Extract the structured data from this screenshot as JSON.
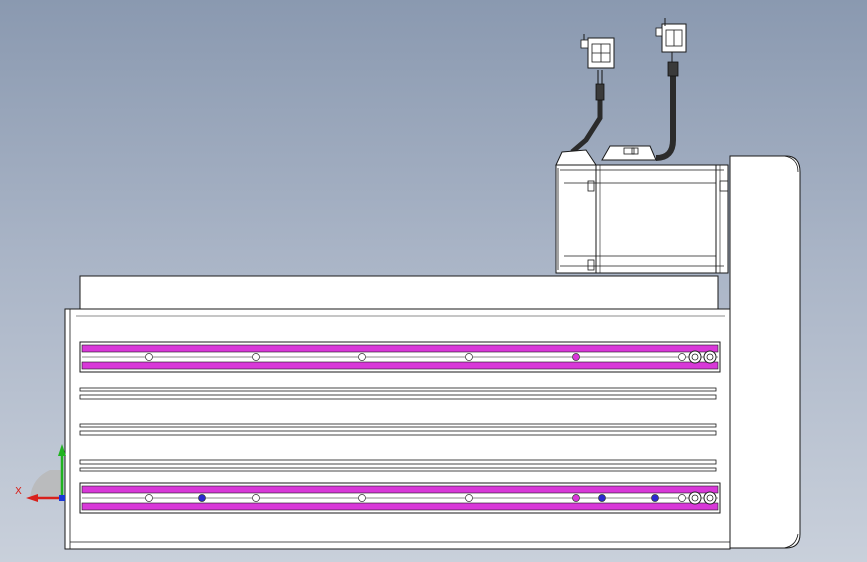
{
  "viewport": {
    "background_top": "#8a99b0",
    "background_bottom": "#c9d0db"
  },
  "triad": {
    "x_label": "X",
    "x_color": "#d8201a",
    "y_color": "#1fb31f",
    "z_color": "#1a37d8"
  },
  "colors": {
    "body": "#ffffff",
    "outline": "#1a1a1a",
    "slot": "#d838d8",
    "hole_blue": "#2a2ad0",
    "cable": "#2b2b2b"
  },
  "rails": {
    "top_holes": [
      "white",
      "white",
      "white",
      "white",
      "magenta"
    ],
    "bottom_holes": [
      "white",
      "blue",
      "white",
      "white",
      "white",
      "magenta",
      "blue",
      "blue"
    ]
  }
}
